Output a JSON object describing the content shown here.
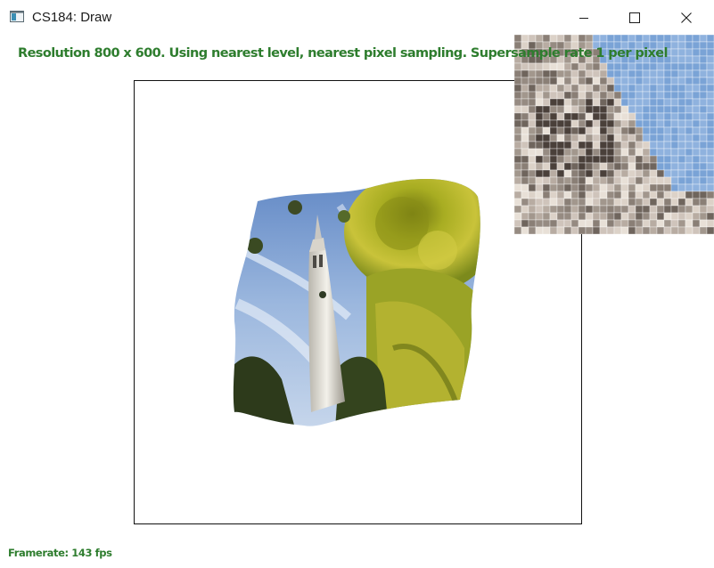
{
  "window": {
    "title": "CS184: Draw",
    "icon": "app-window-icon",
    "controls": [
      "minimize-icon",
      "maximize-icon",
      "close-icon"
    ]
  },
  "status": {
    "text": "Resolution 800 x 600. Using nearest level, nearest pixel sampling. Supersample rate 1 per pixel",
    "color": "#2e7d2e"
  },
  "footer": {
    "framerate": "Framerate: 143 fps"
  },
  "scene": {
    "canvas_border": "#111111",
    "image": "warped texture of Berkeley Campanile with trees and sky",
    "zoom_inset": "pixel magnifier of Campanile clock face"
  }
}
